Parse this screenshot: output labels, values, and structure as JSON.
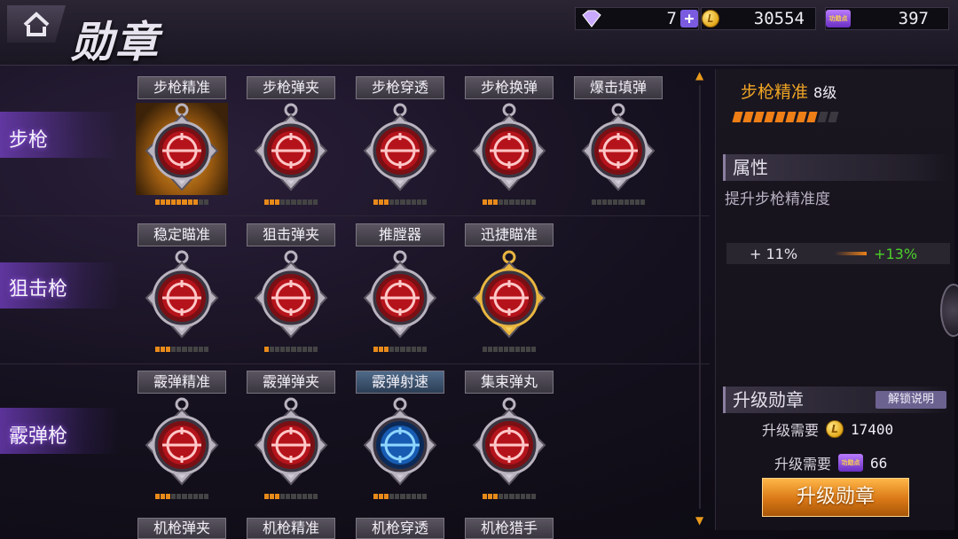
{
  "header": {
    "title": "勋章",
    "gems": "7",
    "coins": "30554",
    "merit": "397",
    "merit_icon_text": "功勋点"
  },
  "categories": [
    {
      "label": "步枪"
    },
    {
      "label": "狙击枪"
    },
    {
      "label": "霰弹枪"
    }
  ],
  "rows": [
    [
      {
        "name": "步枪精准",
        "icon": "rifle-crosshair-icon",
        "level": 8,
        "max": 10,
        "lit": true
      },
      {
        "name": "步枪弹夹",
        "icon": "magazine-icon",
        "level": 3,
        "max": 10
      },
      {
        "name": "步枪穿透",
        "icon": "bullet-pierce-icon",
        "level": 3,
        "max": 10
      },
      {
        "name": "步枪换弹",
        "icon": "reload-icon",
        "level": 3,
        "max": 10
      },
      {
        "name": "爆击填弹",
        "icon": "crit-reload-icon",
        "level": 0,
        "max": 10
      }
    ],
    [
      {
        "name": "稳定瞄准",
        "icon": "steady-aim-icon",
        "level": 3,
        "max": 10
      },
      {
        "name": "狙击弹夹",
        "icon": "magazine-icon",
        "level": 1,
        "max": 10
      },
      {
        "name": "推膛器",
        "icon": "bolt-action-icon",
        "level": 3,
        "max": 10
      },
      {
        "name": "迅捷瞄准",
        "icon": "quick-scope-icon",
        "level": 0,
        "max": 10,
        "gold": true
      }
    ],
    [
      {
        "name": "霰弹精准",
        "icon": "shotgun-crosshair-icon",
        "level": 3,
        "max": 10
      },
      {
        "name": "霰弹弹夹",
        "icon": "magazine-icon",
        "level": 3,
        "max": 10
      },
      {
        "name": "霰弹射速",
        "icon": "crossed-guns-icon",
        "level": 3,
        "max": 10,
        "blue": true
      },
      {
        "name": "集束弹丸",
        "icon": "shotgun-shell-icon",
        "level": 3,
        "max": 10
      }
    ]
  ],
  "cutoff_row": [
    "机枪弹夹",
    "机枪精准",
    "机枪穿透",
    "机枪猎手"
  ],
  "detail": {
    "name": "步枪精准",
    "level": "8级",
    "level_value": 8,
    "level_max": 10,
    "attr_title": "属性",
    "desc": "提升步枪精准度",
    "current": "+ 11%",
    "next": "+13%",
    "upgrade_title": "升级勋章",
    "unlock_label": "解锁说明",
    "req_label": "升级需要",
    "req_coins": "17400",
    "req_merit": "66",
    "upgrade_button": "升级勋章"
  },
  "colors": {
    "accent": "#f0a524",
    "bar_on": "#ee7e16",
    "green": "#4bd12a",
    "medal_red": "#c0141c"
  }
}
